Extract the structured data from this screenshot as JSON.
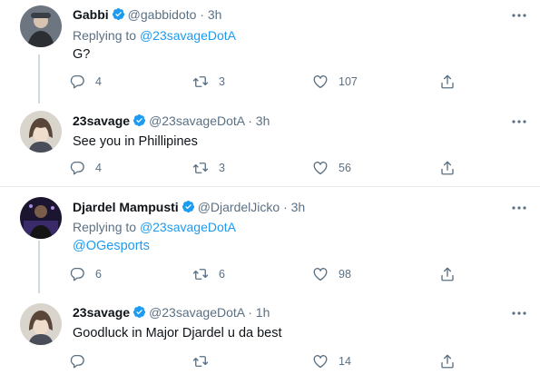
{
  "tweets": [
    {
      "name": "Gabbi",
      "handle": "@gabbidoto",
      "time": "· 3h",
      "reply_prefix": "Replying to",
      "reply_to": "@23savageDotA",
      "text": "G?",
      "replies": "4",
      "retweets": "3",
      "likes": "107"
    },
    {
      "name": "23savage",
      "handle": "@23savageDotA",
      "time": "· 3h",
      "text": "See you in Phillipines",
      "replies": "4",
      "retweets": "3",
      "likes": "56"
    },
    {
      "name": "Djardel Mampusti",
      "handle": "@DjardelJicko",
      "time": "· 3h",
      "reply_prefix": "Replying to",
      "reply_to": "@23savageDotA",
      "text": "@OGesports",
      "replies": "6",
      "retweets": "6",
      "likes": "98"
    },
    {
      "name": "23savage",
      "handle": "@23savageDotA",
      "time": "· 1h",
      "text": "Goodluck in Major Djardel u da best",
      "replies": "",
      "retweets": "",
      "likes": "14"
    }
  ],
  "colors": {
    "accent": "#1d9bf0",
    "muted": "#5b7083",
    "thread_line": "#cfd9de"
  },
  "icons": [
    "verified-badge-icon",
    "more-icon",
    "reply-icon",
    "retweet-icon",
    "like-icon",
    "share-icon"
  ]
}
